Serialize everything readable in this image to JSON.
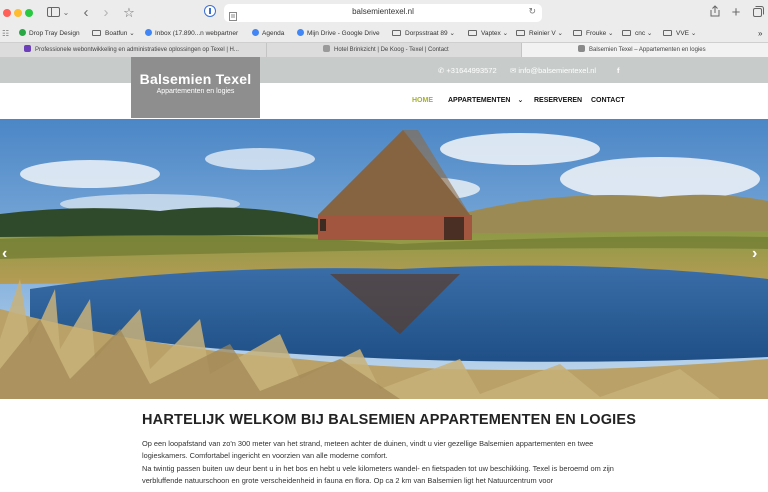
{
  "browser": {
    "url": "balsemientexel.nl",
    "bookmarks": [
      {
        "label": "Drop Tray Design",
        "kind": "site"
      },
      {
        "label": "Boatfun",
        "kind": "folder"
      },
      {
        "label": "Inbox (17.890...n webpartner",
        "kind": "site"
      },
      {
        "label": "Agenda",
        "kind": "site"
      },
      {
        "label": "Mijn Drive - Google Drive",
        "kind": "site"
      },
      {
        "label": "Dorpsstraat 89",
        "kind": "folder"
      },
      {
        "label": "Vaptex",
        "kind": "folder"
      },
      {
        "label": "Reinier V",
        "kind": "folder"
      },
      {
        "label": "Frouke",
        "kind": "folder"
      },
      {
        "label": "cnc",
        "kind": "folder"
      },
      {
        "label": "VVE",
        "kind": "folder"
      }
    ],
    "tabs": [
      {
        "label": "Professionele webontwikkeling en administratieve oplossingen op Texel | H...",
        "favicon": "Y"
      },
      {
        "label": "Hotel Brinkzicht | De Koog - Texel | Contact",
        "favicon": "H"
      },
      {
        "label": "Balsemien Texel – Appartementen en logies",
        "favicon": "B",
        "active": true
      }
    ]
  },
  "site": {
    "logo": {
      "title": "Balsemien Texel",
      "subtitle": "Appartementen en logies"
    },
    "contact": {
      "phone": "+31644993572",
      "email": "info@balsemientexel.nl",
      "social": "f"
    },
    "nav": [
      {
        "label": "HOME",
        "active": true
      },
      {
        "label": "APPARTEMENTEN",
        "has_dropdown": true
      },
      {
        "label": "RESERVEREN"
      },
      {
        "label": "CONTACT"
      }
    ],
    "hero": {
      "prev_arrow": "‹",
      "next_arrow": "›"
    },
    "content": {
      "heading": "HARTELIJK WELKOM BIJ BALSEMIEN APPARTEMENTEN EN LOGIES",
      "paragraph_1": "Op een loopafstand van zo'n 300 meter van het strand, meteen achter de duinen, vindt u vier gezellige Balsemien appartementen en twee logieskamers. Comfortabel ingericht en voorzien van alle moderne comfort.",
      "paragraph_2": "Na twintig passen buiten uw deur bent u in het bos en hebt u vele kilometers wandel- en fietspaden tot uw beschikking. Texel is beroemd om zijn verbluffende natuurschoon en grote verscheidenheid in fauna en flora. Op ca 2 km van Balsemien ligt het Natuurcentrum voor"
    }
  },
  "colors": {
    "accent": "#a5b02c",
    "topbar": "#c7ccca",
    "logo_bg": "#8e8e8e"
  }
}
